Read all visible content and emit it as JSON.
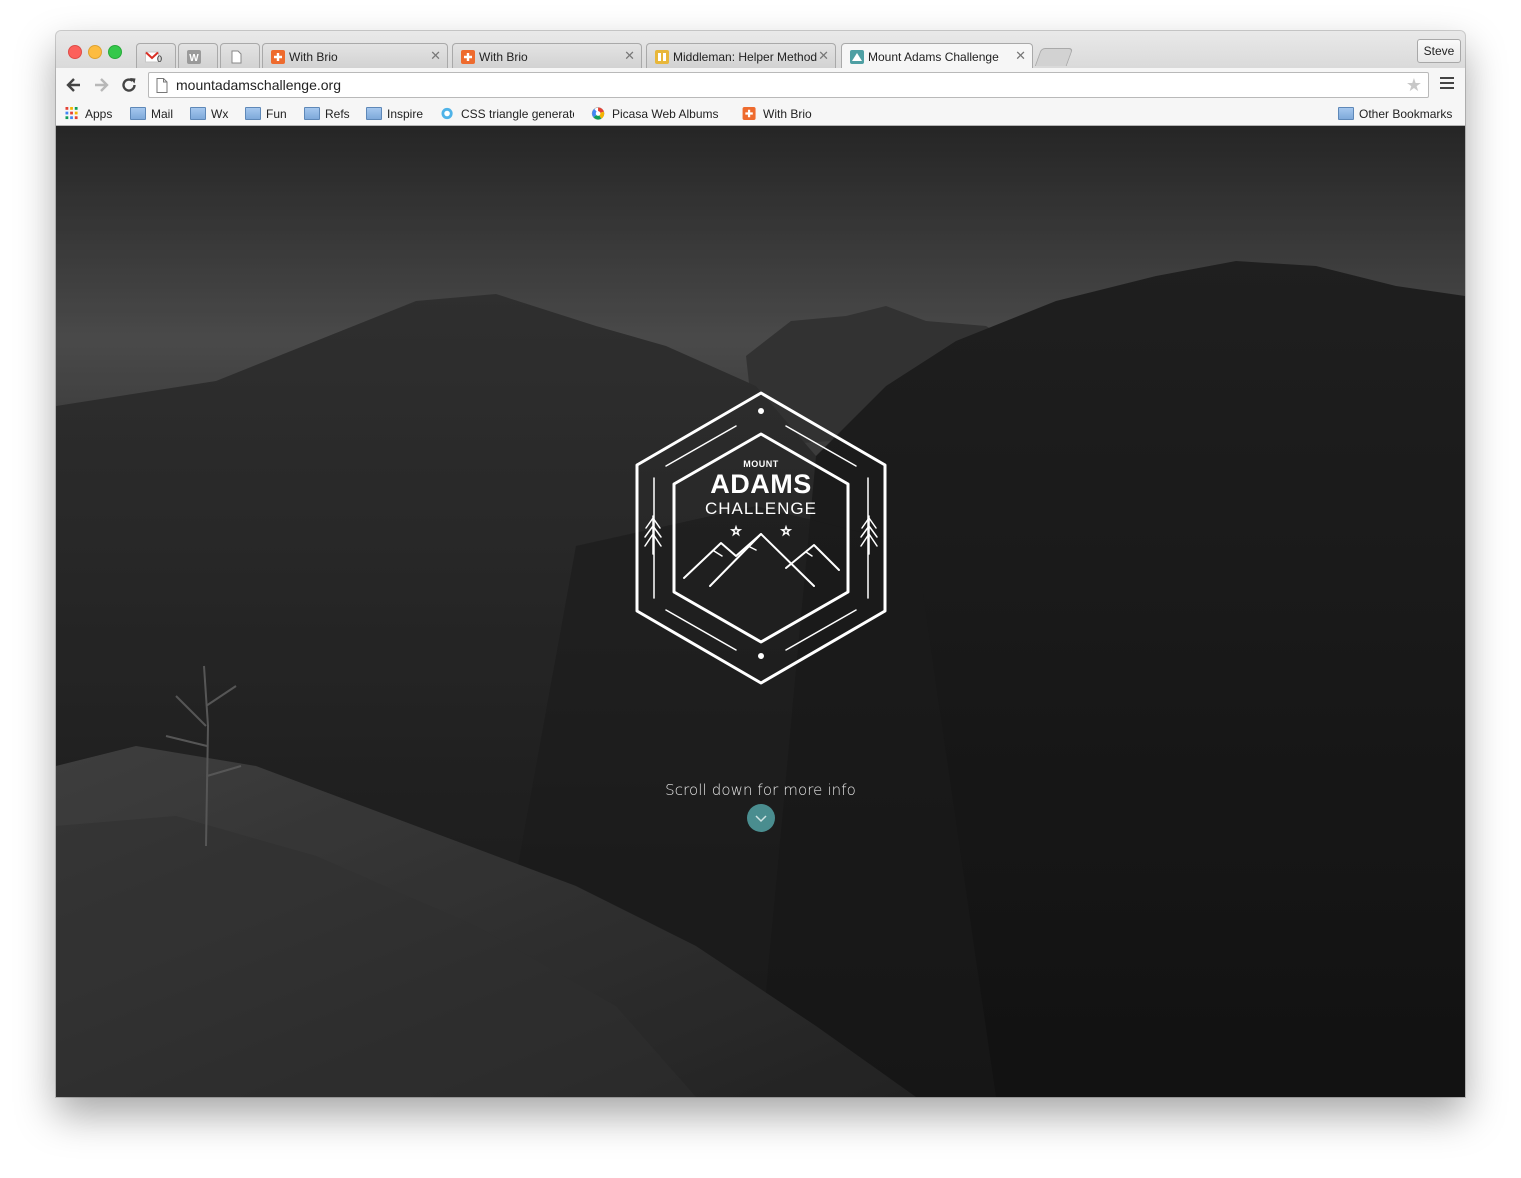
{
  "browser": {
    "tabs": [
      {
        "title": "",
        "icon": "gmail-icon",
        "badge": "0"
      },
      {
        "title": "",
        "icon": "w-icon"
      },
      {
        "title": "",
        "icon": "blank-page-icon"
      },
      {
        "title": "With Brio",
        "icon": "brio-plus-icon"
      },
      {
        "title": "With Brio",
        "icon": "brio-plus-icon"
      },
      {
        "title": "Middleman: Helper Methods",
        "icon": "middleman-icon"
      },
      {
        "title": "Mount Adams Challenge",
        "icon": "mountain-icon",
        "active": true
      }
    ],
    "profile_name": "Steve",
    "address_url": "mountadamschallenge.org",
    "bookmarks": [
      {
        "label": "Apps",
        "icon": "apps-grid-icon"
      },
      {
        "label": "Mail",
        "icon": "folder-icon"
      },
      {
        "label": "Wx",
        "icon": "folder-icon"
      },
      {
        "label": "Fun",
        "icon": "folder-icon"
      },
      {
        "label": "Refs",
        "icon": "folder-icon"
      },
      {
        "label": "Inspire",
        "icon": "folder-icon"
      },
      {
        "label": "CSS triangle generator",
        "icon": "css-triangle-icon"
      },
      {
        "label": "Picasa Web Albums",
        "icon": "picasa-icon"
      },
      {
        "label": "With Brio",
        "icon": "brio-plus-icon"
      }
    ],
    "other_bookmarks": "Other Bookmarks"
  },
  "page": {
    "logo": {
      "line1": "MOUNT",
      "line2": "ADAMS",
      "line3": "CHALLENGE"
    },
    "scroll_text": "Scroll down for more info",
    "accent": "#4a8d8f"
  }
}
